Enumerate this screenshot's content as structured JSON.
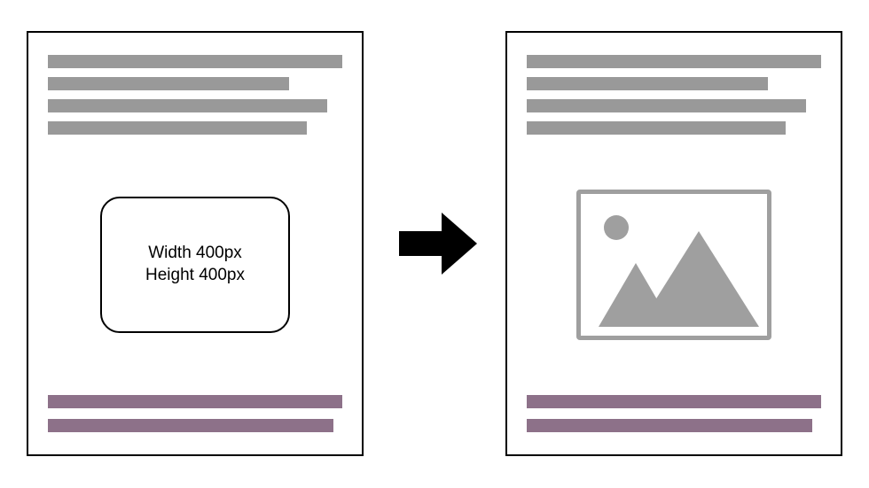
{
  "diagram": {
    "kind": "image-placeholder-to-render",
    "left_page": {
      "top_text_bars": 4,
      "placeholder": {
        "line1": "Width 400px",
        "line2": "Height 400px"
      },
      "footer_bars": 2,
      "footer_color": "#8d7189"
    },
    "arrow": {
      "direction": "right"
    },
    "right_page": {
      "top_text_bars": 4,
      "image_placeholder_icon": true,
      "footer_bars": 2,
      "footer_color": "#8d7189"
    },
    "colors": {
      "text_bar": "#999999",
      "footer_bar": "#8d7189",
      "border": "#000000",
      "image_icon": "#9f9f9f"
    }
  }
}
